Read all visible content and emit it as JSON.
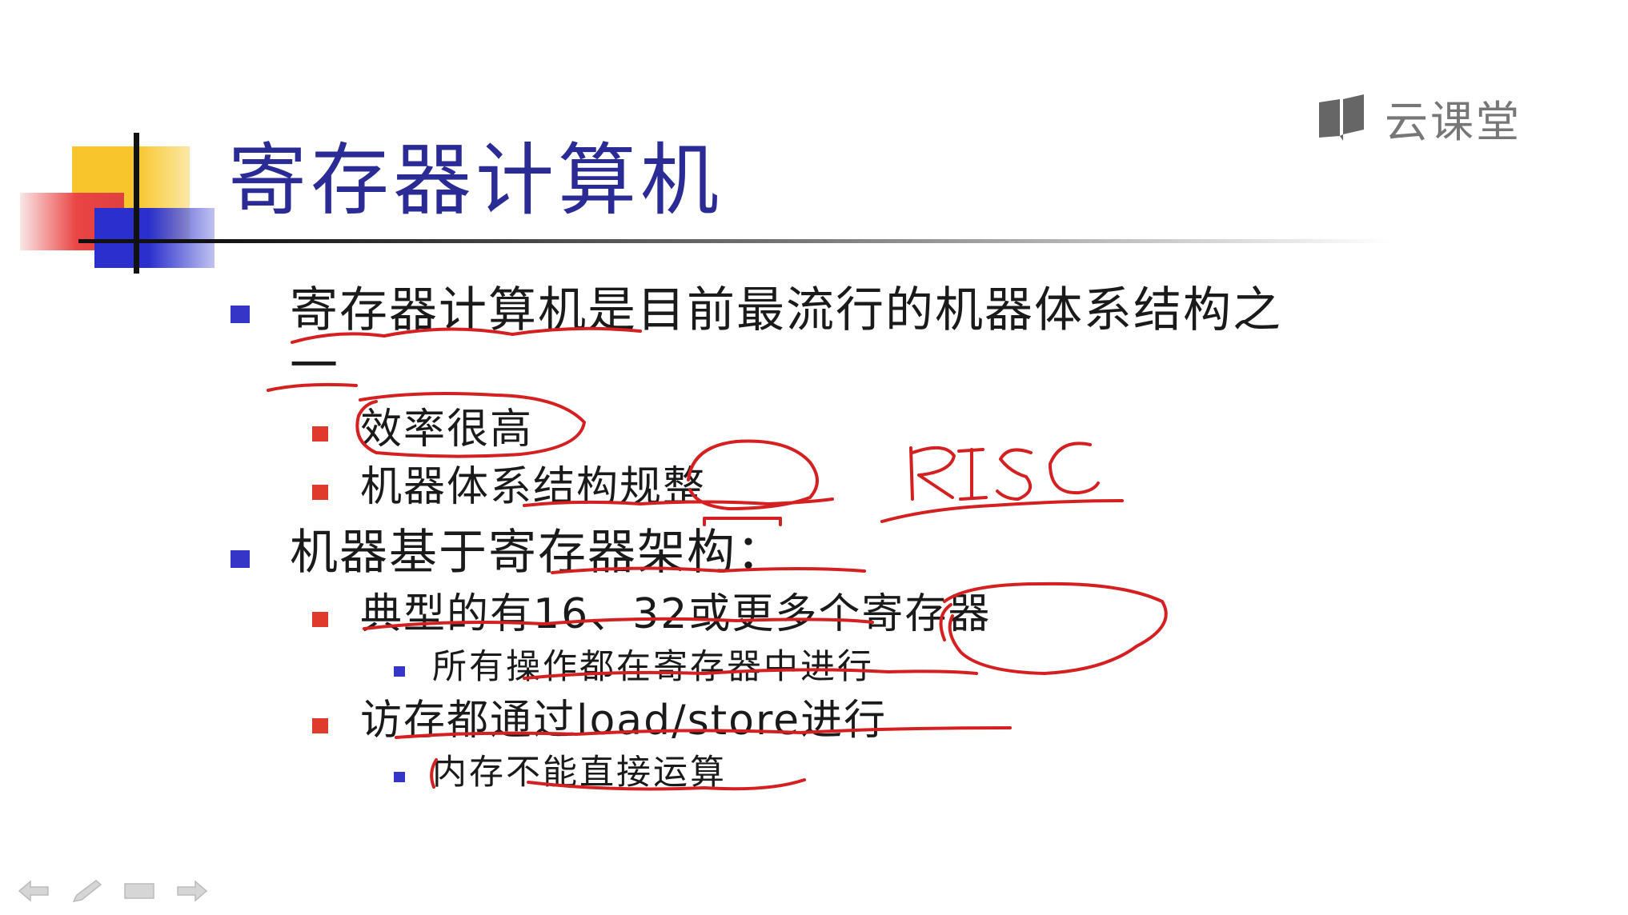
{
  "slide": {
    "title": "寄存器计算机",
    "brand": {
      "name": "云课堂",
      "icon": "book-icon"
    },
    "bullets": [
      {
        "text": "寄存器计算机是目前最流行的机器体系结构之",
        "cont": "一"
      },
      {
        "text": "效率很高"
      },
      {
        "text": "机器体系结构规整"
      },
      {
        "text": "机器基于寄存器架构："
      },
      {
        "text": "典型的有16、32或更多个寄存器"
      },
      {
        "text": "所有操作都在寄存器中进行"
      },
      {
        "text": "访存都通过load/store进行"
      },
      {
        "text": "内存不能直接运算"
      }
    ],
    "annotation": "RISC"
  },
  "nav": [
    {
      "label": "previous",
      "icon": "arrow-left-icon"
    },
    {
      "label": "pen",
      "icon": "pen-icon"
    },
    {
      "label": "menu",
      "icon": "slide-menu-icon"
    },
    {
      "label": "next",
      "icon": "arrow-right-icon"
    }
  ],
  "colors": {
    "title": "#2b2b95",
    "bullet_blue": "#3535c8",
    "bullet_red": "#e03a2c",
    "ink": "#d42020",
    "brand": "#777777"
  }
}
